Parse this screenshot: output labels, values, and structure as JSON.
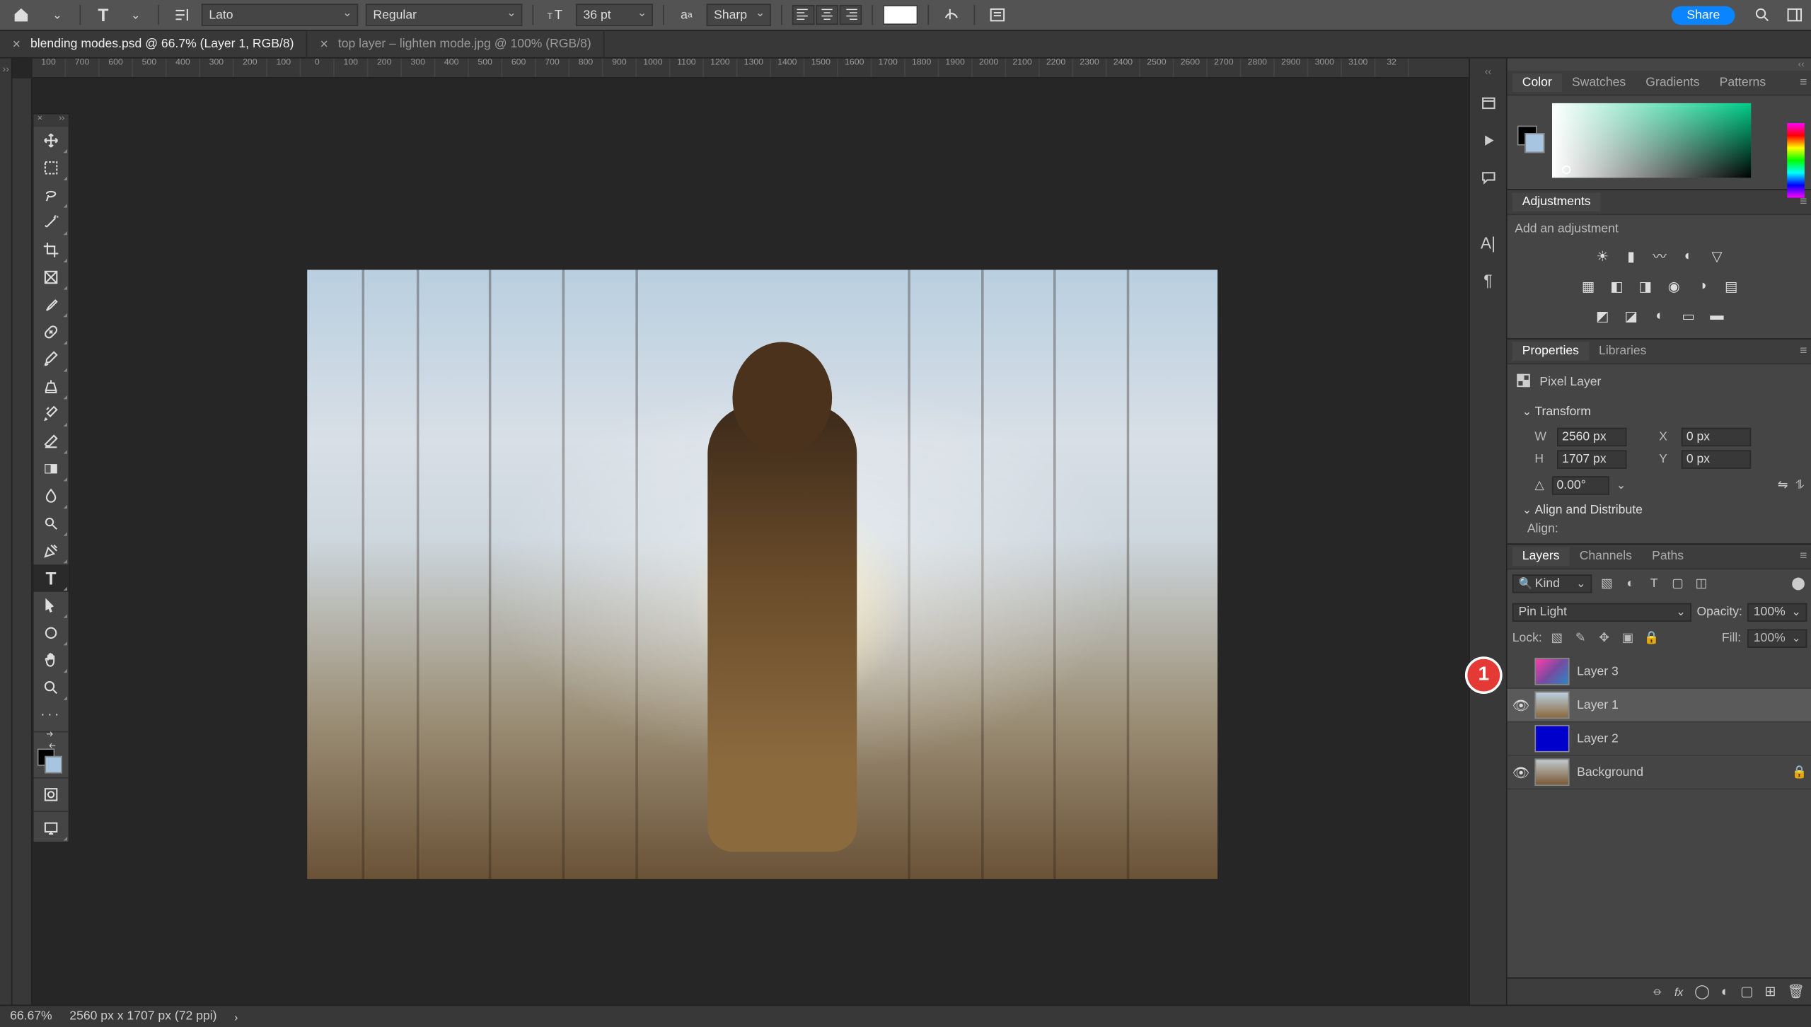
{
  "options_bar": {
    "font_family": "Lato",
    "font_weight": "Regular",
    "font_size": "36 pt",
    "anti_alias": "Sharp",
    "share": "Share"
  },
  "tabs": [
    {
      "title": "blending modes.psd @ 66.7% (Layer 1, RGB/8)",
      "active": true
    },
    {
      "title": "top layer – lighten mode.jpg @ 100% (RGB/8)",
      "active": false
    }
  ],
  "ruler_marks": [
    "100",
    "700",
    "600",
    "500",
    "400",
    "300",
    "200",
    "100",
    "0",
    "100",
    "200",
    "300",
    "400",
    "500",
    "600",
    "700",
    "800",
    "900",
    "1000",
    "1100",
    "1200",
    "1300",
    "1400",
    "1500",
    "1600",
    "1700",
    "1800",
    "1900",
    "2000",
    "2100",
    "2200",
    "2300",
    "2400",
    "2500",
    "2600",
    "2700",
    "2800",
    "2900",
    "3000",
    "3100",
    "32"
  ],
  "color_panel": {
    "tabs": [
      "Color",
      "Swatches",
      "Gradients",
      "Patterns"
    ]
  },
  "adjustments": {
    "title": "Adjustments",
    "hint": "Add an adjustment"
  },
  "properties": {
    "tabs": [
      "Properties",
      "Libraries"
    ],
    "layer_kind": "Pixel Layer",
    "transform": {
      "title": "Transform",
      "W": "2560 px",
      "X": "0 px",
      "H": "1707 px",
      "Y": "0 px",
      "angle": "0.00°"
    },
    "align_title": "Align and Distribute",
    "align_label": "Align:"
  },
  "layers_panel": {
    "tabs": [
      "Layers",
      "Channels",
      "Paths"
    ],
    "filter_label": "Kind",
    "blend_mode": "Pin Light",
    "opacity_label": "Opacity:",
    "opacity": "100%",
    "lock_label": "Lock:",
    "fill_label": "Fill:",
    "fill": "100%",
    "layers": [
      {
        "name": "Layer 3",
        "visible": false,
        "selected": false,
        "locked": false
      },
      {
        "name": "Layer 1",
        "visible": true,
        "selected": true,
        "locked": false
      },
      {
        "name": "Layer 2",
        "visible": false,
        "selected": false,
        "locked": false
      },
      {
        "name": "Background",
        "visible": true,
        "selected": false,
        "locked": true
      }
    ]
  },
  "status": {
    "zoom": "66.67%",
    "dims": "2560 px x 1707 px (72 ppi)"
  },
  "annotations": {
    "a1": "1"
  }
}
